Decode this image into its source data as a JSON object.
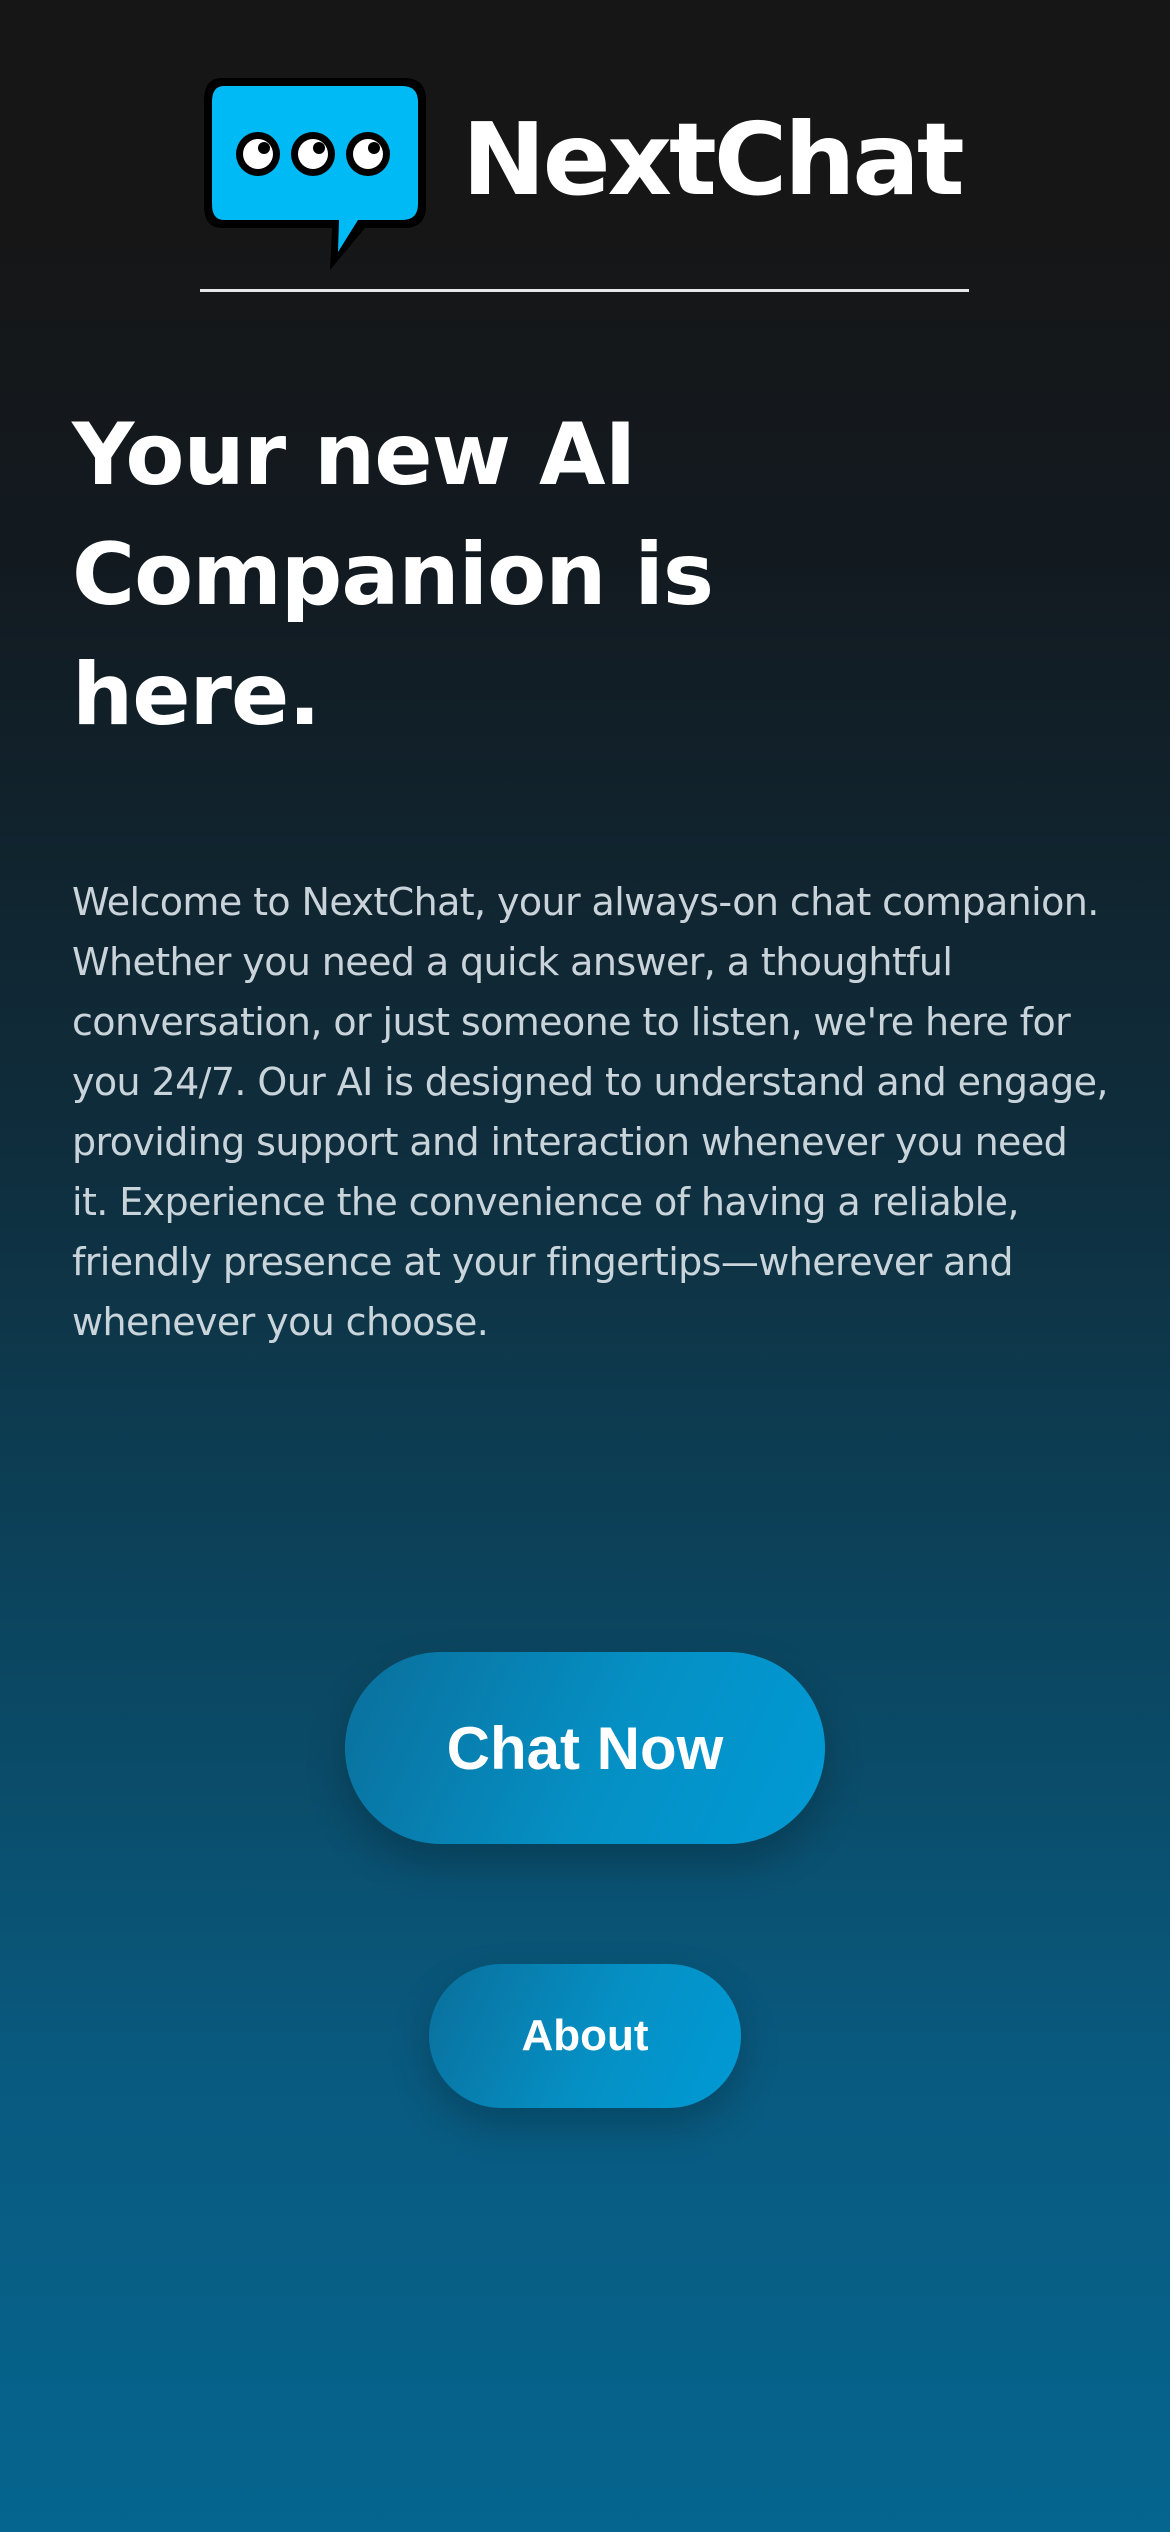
{
  "header": {
    "logo_icon": "chat-bubble-icon",
    "brand_name": "NextChat"
  },
  "hero": {
    "headline_line1": "Your new AI",
    "headline_line2": "Companion is",
    "headline_line3": "here.",
    "description": "Welcome to NextChat, your always-on chat companion. Whether you need a quick answer, a thoughtful conversation, or just someone to listen, we're here for you 24/7. Our AI is designed to understand and engage, providing support and interaction whenever you need it. Experience the convenience of having a reliable, friendly presence at your fingertips—wherever and whenever you choose."
  },
  "actions": {
    "chat_now_label": "Chat Now",
    "about_label": "About"
  },
  "colors": {
    "background_top": "#161616",
    "background_bottom": "#05658e",
    "accent": "#00baf5",
    "button": "#0590c4"
  }
}
